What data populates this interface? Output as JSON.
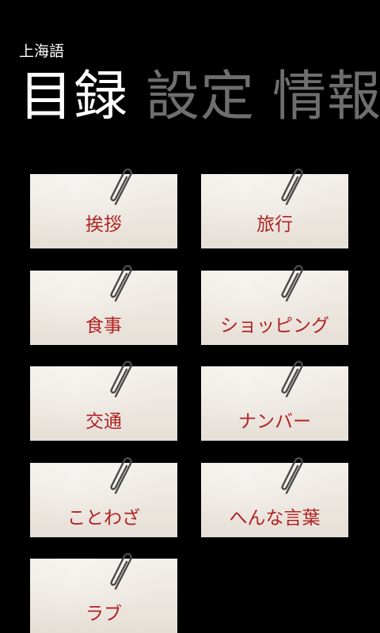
{
  "app": {
    "title": "上海語"
  },
  "pivot": {
    "items": [
      {
        "label": "目録",
        "active": true
      },
      {
        "label": "設定",
        "active": false
      },
      {
        "label": "情報",
        "active": false
      }
    ]
  },
  "categories": [
    {
      "label": "挨拶"
    },
    {
      "label": "旅行"
    },
    {
      "label": "食事"
    },
    {
      "label": "ショッピング"
    },
    {
      "label": "交通"
    },
    {
      "label": "ナンバー"
    },
    {
      "label": "ことわざ"
    },
    {
      "label": "へんな言葉"
    },
    {
      "label": "ラブ"
    }
  ],
  "colors": {
    "background": "#000000",
    "active_header": "#ffffff",
    "inactive_header": "#6e6e6e",
    "note_paper": "#ece6df",
    "label_red": "#b02323",
    "clip_metal": "#4a4a4a"
  },
  "icons": {
    "clip": "paperclip-icon"
  }
}
